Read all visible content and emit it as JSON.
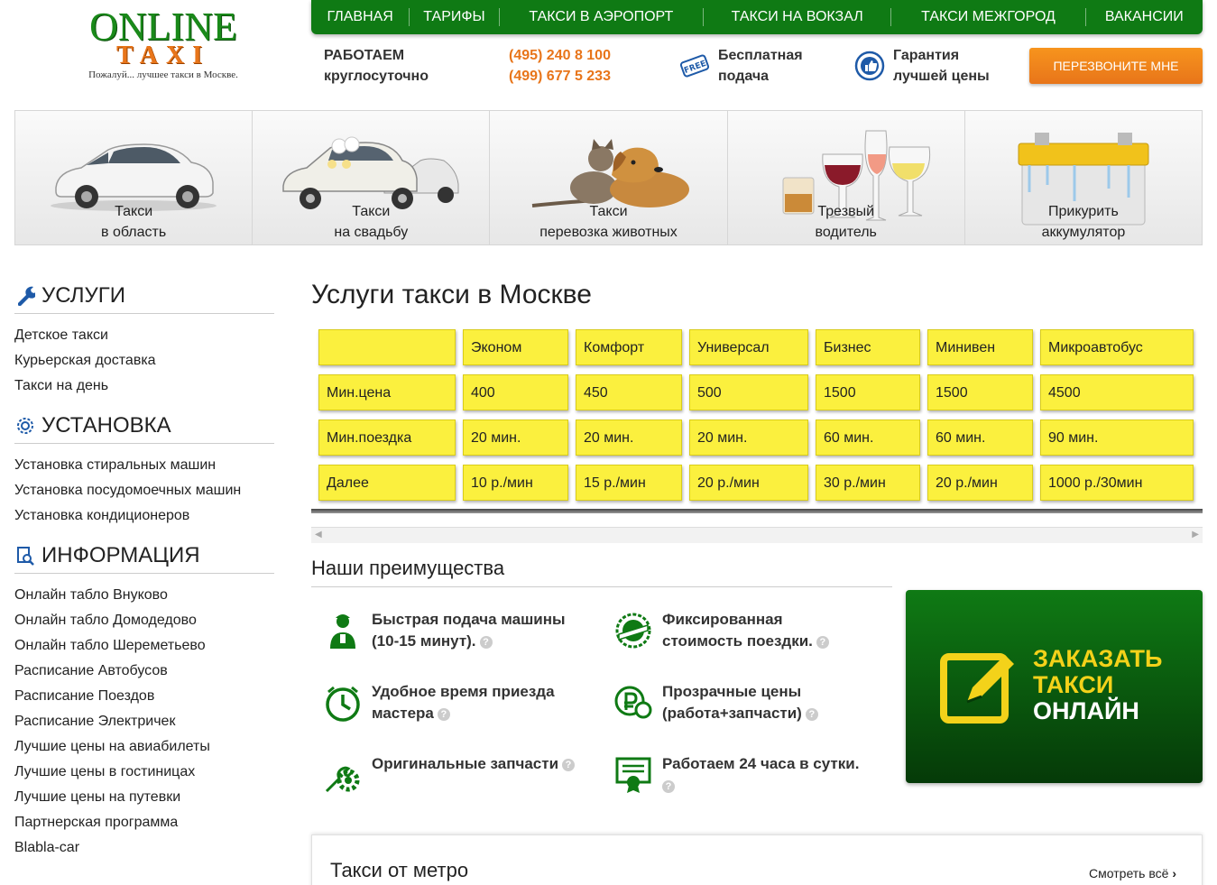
{
  "logo": {
    "line1": "ONLINE",
    "line2": "TAXI",
    "tagline": "Пожалуй... лучшее такси в Москве."
  },
  "nav": [
    "ГЛАВНАЯ",
    "ТАРИФЫ",
    "ТАКСИ В АЭРОПОРТ",
    "ТАКСИ НА ВОКЗАЛ",
    "ТАКСИ МЕЖГОРОД",
    "ВАКАНСИИ"
  ],
  "header": {
    "work_line1": "РАБОТАЕМ",
    "work_line2": "круглосуточно",
    "phone1": "(495) 240 8 100",
    "phone2": "(499) 677 5 233",
    "free_icon_text": "FREE",
    "free_line1": "Бесплатная",
    "free_line2": "подача",
    "guarantee_line1": "Гарантия",
    "guarantee_line2": "лучшей цены",
    "callback": "ПЕРЕЗВОНИТЕ МНЕ"
  },
  "tiles": [
    {
      "line1": "Такси",
      "line2": "в область",
      "icon": "car"
    },
    {
      "line1": "Такси",
      "line2": "на свадьбу",
      "icon": "wedding-car"
    },
    {
      "line1": "Такси",
      "line2": "перевозка животных",
      "icon": "pets"
    },
    {
      "line1": "Трезвый",
      "line2": "водитель",
      "icon": "glasses"
    },
    {
      "line1": "Прикурить",
      "line2": "аккумулятор",
      "icon": "battery"
    }
  ],
  "sidebar": {
    "services": {
      "title": "УСЛУГИ",
      "items": [
        "Детское такси",
        "Курьерская доставка",
        "Такси на день"
      ]
    },
    "install": {
      "title": "УСТАНОВКА",
      "items": [
        "Установка стиральных машин",
        "Установка посудомоечных машин",
        "Установка кондиционеров"
      ]
    },
    "info": {
      "title": "ИНФОРМАЦИЯ",
      "items": [
        "Онлайн табло Внуково",
        "Онлайн табло Домодедово",
        "Онлайн табло Шереметьево",
        "Расписание Автобусов",
        "Расписание Поездов",
        "Расписание Электричек",
        "Лучшие цены на авиабилеты",
        "Лучшие цены в гостиницах",
        "Лучшие цены на путевки",
        "Партнерская программа",
        "Blabla-car"
      ]
    }
  },
  "main": {
    "title": "Услуги такси в Москве",
    "tariff_table": {
      "header": [
        "",
        "Эконом",
        "Комфорт",
        "Универсал",
        "Бизнес",
        "Минивен",
        "Микроавтобус"
      ],
      "rows": [
        [
          "Мин.цена",
          "400",
          "450",
          "500",
          "1500",
          "1500",
          "4500"
        ],
        [
          "Мин.поездка",
          "20 мин.",
          "20 мин.",
          "20 мин.",
          "60 мин.",
          "60 мин.",
          "90 мин."
        ],
        [
          "Далее",
          "10 р./мин",
          "15 р./мин",
          "20 р./мин",
          "30 р./мин",
          "20 р./мин",
          "1000 р./30мин"
        ]
      ]
    },
    "advantages_title": "Наши преимущества",
    "advantages": [
      {
        "line1": "Быстрая подача машины",
        "line2": "(10-15 минут).",
        "icon": "driver"
      },
      {
        "line1": "Фиксированная",
        "line2": "стоимость поездки.",
        "icon": "badge-100"
      },
      {
        "line1": "Удобное время приезда",
        "line2": "мастера",
        "icon": "clock"
      },
      {
        "line1": "Прозрачные цены",
        "line2": "(работа+запчасти)",
        "icon": "ruble"
      },
      {
        "line1": "Оригинальные запчасти",
        "line2": "",
        "icon": "wrench-gear"
      },
      {
        "line1": "Работаем 24 часа в сутки.",
        "line2": "",
        "icon": "certificate"
      }
    ],
    "order": {
      "line1": "ЗАКАЗАТЬ",
      "line2": "ТАКСИ",
      "line3": "ОНЛАЙН"
    },
    "metro": {
      "title": "Такси от метро",
      "see_all": "Смотреть всё"
    }
  },
  "colors": {
    "green": "#0f7a14",
    "orange": "#e8751a",
    "yellow": "#fbf03e"
  }
}
